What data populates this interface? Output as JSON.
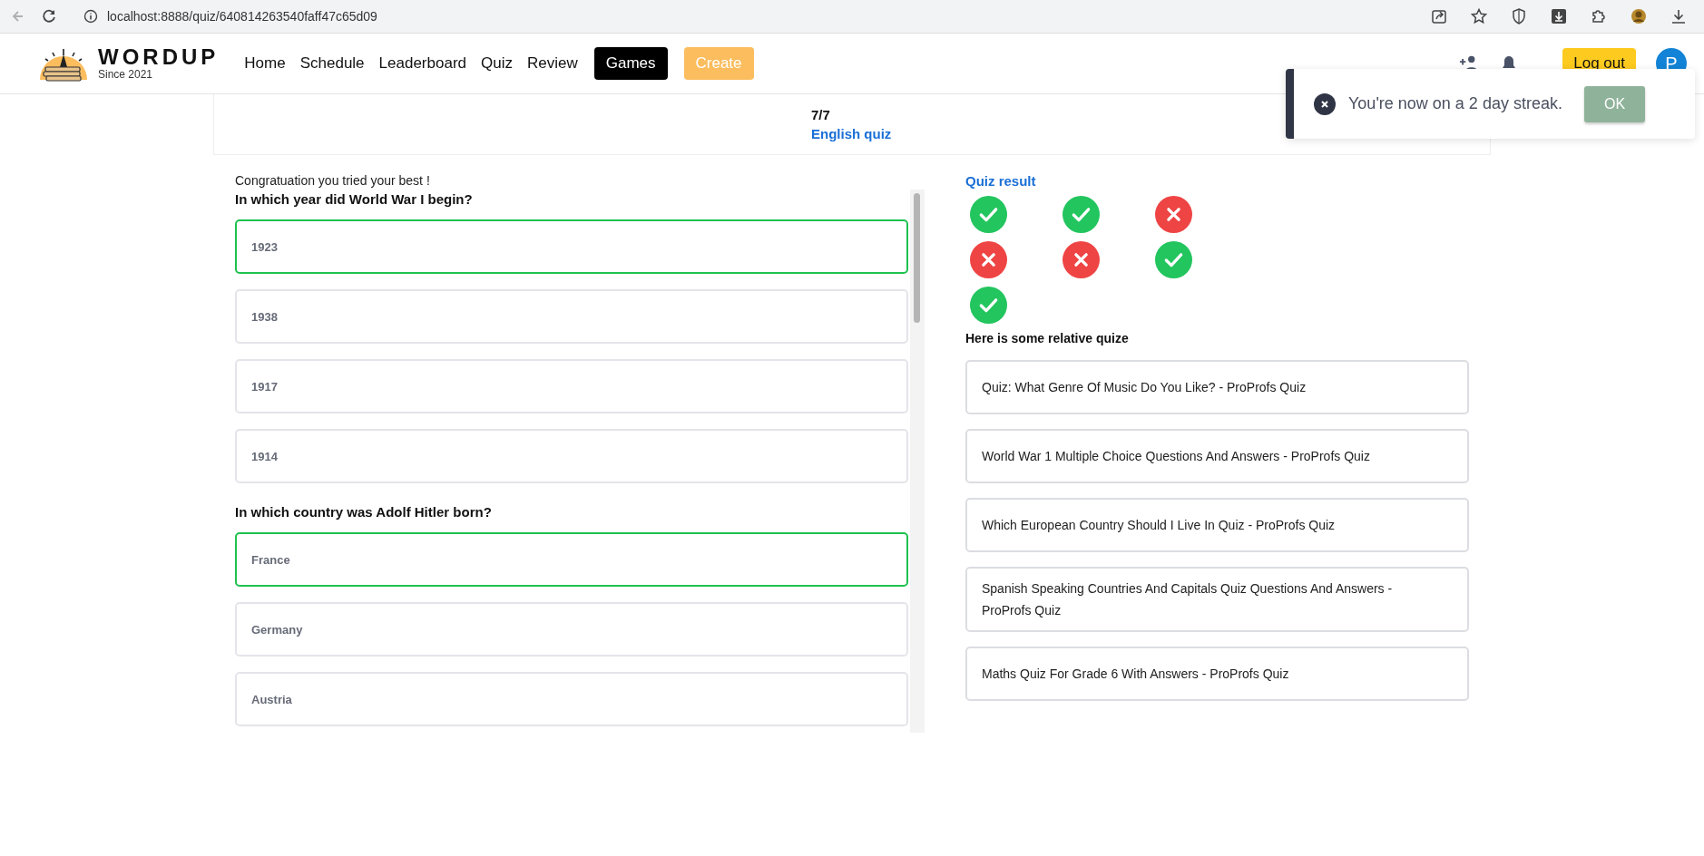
{
  "browser": {
    "url": "localhost:8888/quiz/640814263540faff47c65d09"
  },
  "header": {
    "logo": {
      "name": "WORDUP",
      "tagline": "Since 2021"
    },
    "nav": [
      {
        "label": "Home",
        "kind": "link"
      },
      {
        "label": "Schedule",
        "kind": "link"
      },
      {
        "label": "Leaderboard",
        "kind": "link"
      },
      {
        "label": "Quiz",
        "kind": "link"
      },
      {
        "label": "Review",
        "kind": "link"
      },
      {
        "label": "Games",
        "kind": "dark"
      },
      {
        "label": "Create",
        "kind": "accent"
      }
    ],
    "logout": "Log out",
    "avatar": "P"
  },
  "toast": {
    "message": "You're now on a 2 day streak.",
    "button": "OK"
  },
  "progress": {
    "count": "7/7",
    "quiz_title": "English quiz"
  },
  "result_message": "Congratuation you tried your best !",
  "questions": [
    {
      "text": "In which year did World War I begin?",
      "answers": [
        {
          "label": "1923",
          "selected": true
        },
        {
          "label": "1938",
          "selected": false
        },
        {
          "label": "1917",
          "selected": false
        },
        {
          "label": "1914",
          "selected": false
        }
      ]
    },
    {
      "text": "In which country was Adolf Hitler born?",
      "answers": [
        {
          "label": "France",
          "selected": true
        },
        {
          "label": "Germany",
          "selected": false
        },
        {
          "label": "Austria",
          "selected": false
        }
      ]
    }
  ],
  "quiz_result": {
    "title": "Quiz result",
    "items": [
      {
        "correct": true
      },
      {
        "correct": true
      },
      {
        "correct": false
      },
      {
        "correct": false
      },
      {
        "correct": false
      },
      {
        "correct": true
      },
      {
        "correct": true
      }
    ]
  },
  "related": {
    "title": "Here is some relative quize",
    "items": [
      "Quiz: What Genre Of Music Do You Like? - ProProfs Quiz",
      "World War 1 Multiple Choice Questions And Answers - ProProfs Quiz",
      "Which European Country Should I Live In Quiz - ProProfs Quiz",
      "Spanish Speaking Countries And Capitals Quiz Questions And Answers - ProProfs Quiz",
      "Maths Quiz For Grade 6 With Answers - ProProfs Quiz"
    ]
  }
}
